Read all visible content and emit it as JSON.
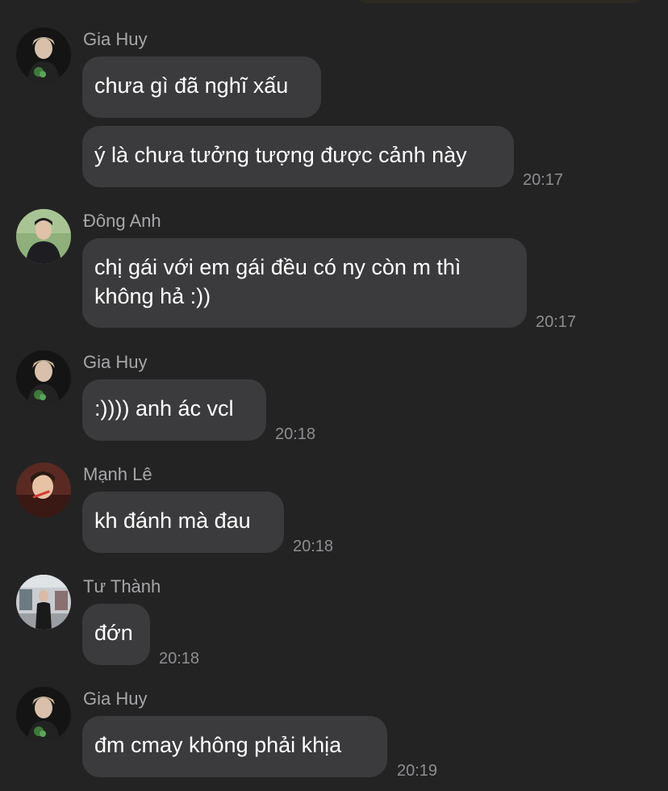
{
  "messages": [
    {
      "sender": "Gia Huy",
      "texts": [
        "chưa gì đã nghĩ xấu",
        "ý là chưa tưởng tượng được cảnh này"
      ],
      "time": "20:17"
    },
    {
      "sender": "Đông Anh",
      "texts": [
        "chị gái với em gái đều có ny còn m thì",
        "không hả :))"
      ],
      "time": "20:17"
    },
    {
      "sender": "Gia Huy",
      "texts": [
        ":)))) anh ác vcl"
      ],
      "time": "20:18"
    },
    {
      "sender": "Mạnh Lê",
      "texts": [
        "kh đánh mà đau"
      ],
      "time": "20:18"
    },
    {
      "sender": "Tư Thành",
      "texts": [
        "đớn"
      ],
      "time": "20:18"
    },
    {
      "sender": "Gia Huy",
      "texts": [
        "đm cmay không phải khịa"
      ],
      "time": "20:19"
    }
  ],
  "colors": {
    "background": "#232324",
    "bubble": "#3b3b3d",
    "sender_name": "#a7a7aa",
    "timestamp": "#8e8e92"
  },
  "icons": [
    "avatar-gia-huy",
    "avatar-dong-anh",
    "avatar-manh-le",
    "avatar-tu-thanh"
  ]
}
